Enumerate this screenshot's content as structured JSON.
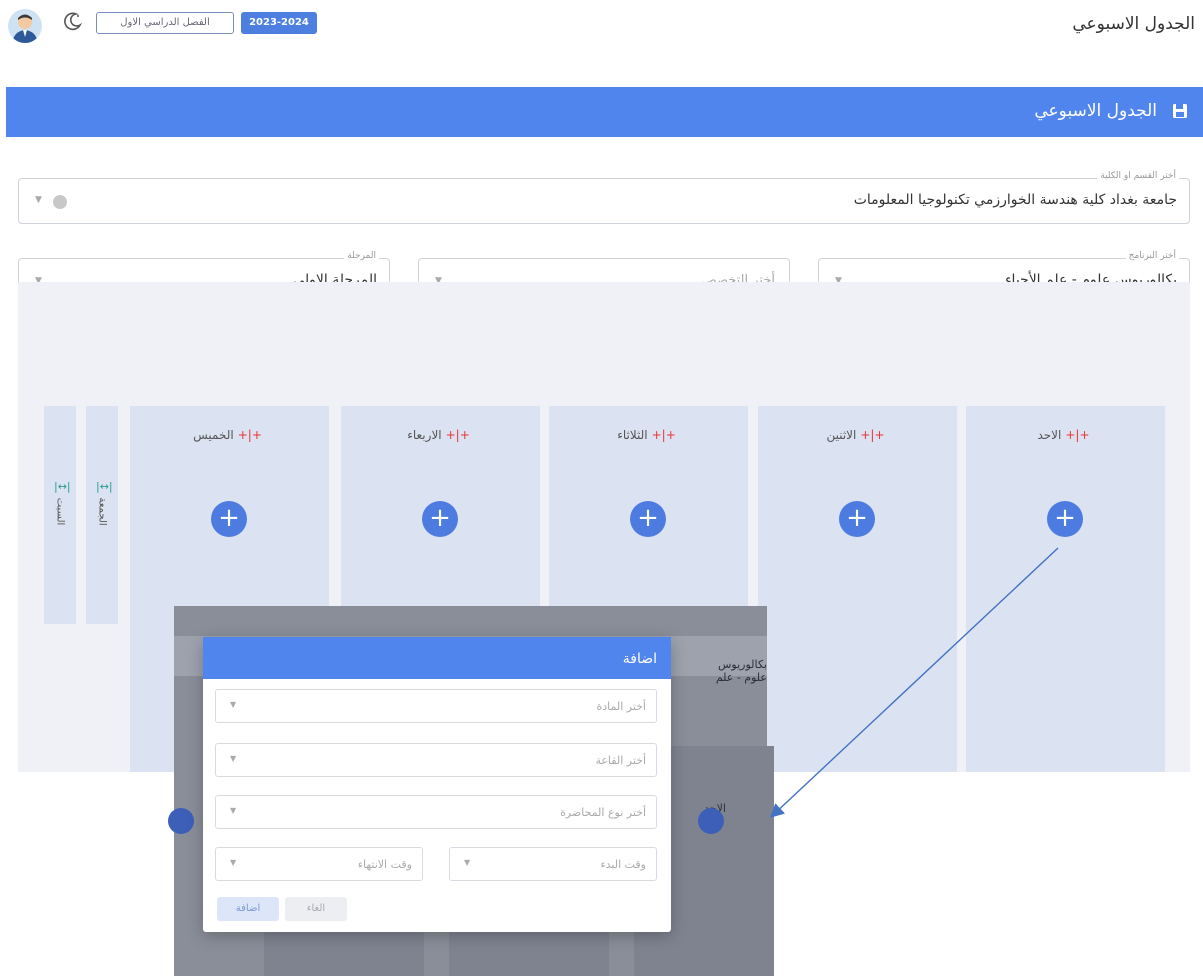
{
  "header": {
    "page_title": "الجدول الاسبوعي",
    "semester_label": "الفصل الدراسي الاول",
    "academic_year": "2023-2024"
  },
  "banner": {
    "title": "الجدول الاسبوعي"
  },
  "filters": {
    "department": {
      "label": "أختر القسم او الكلية",
      "value": "جامعة بغداد كلية هندسة الخوارزمي تكنولوجيا المعلومات"
    },
    "program": {
      "label": "أختر البرنامج",
      "value": "بكالوريوس علوم - علم الأحياء"
    },
    "specialization": {
      "placeholder": "أختر التخصص"
    },
    "stage": {
      "label": "المرحلة",
      "value": "المرحلة الاولى"
    }
  },
  "schedule": {
    "days": [
      "الاحد",
      "الاثنين",
      "الثلاثاء",
      "الاربعاء",
      "الخميس"
    ],
    "side_columns": [
      "الجمعة",
      "السبت"
    ]
  },
  "background_ghost": {
    "program_fragment": "بكالوريوس علوم - علم",
    "day_fragment": "الاحد"
  },
  "modal": {
    "title": "اضافة",
    "fields": {
      "material": "أختر المادة",
      "hall": "أختر القاعة",
      "lecture_type": "أختر نوع المحاضرة",
      "start_time": "وقت البدء",
      "end_time": "وقت الانتهاء"
    },
    "add_label": "اضافة",
    "cancel_label": "الغاء"
  },
  "colors": {
    "primary": "#5185ee",
    "day_column_bg": "#dbe2f1",
    "accent_red": "#e33333",
    "accent_teal": "#2a9d8f"
  }
}
